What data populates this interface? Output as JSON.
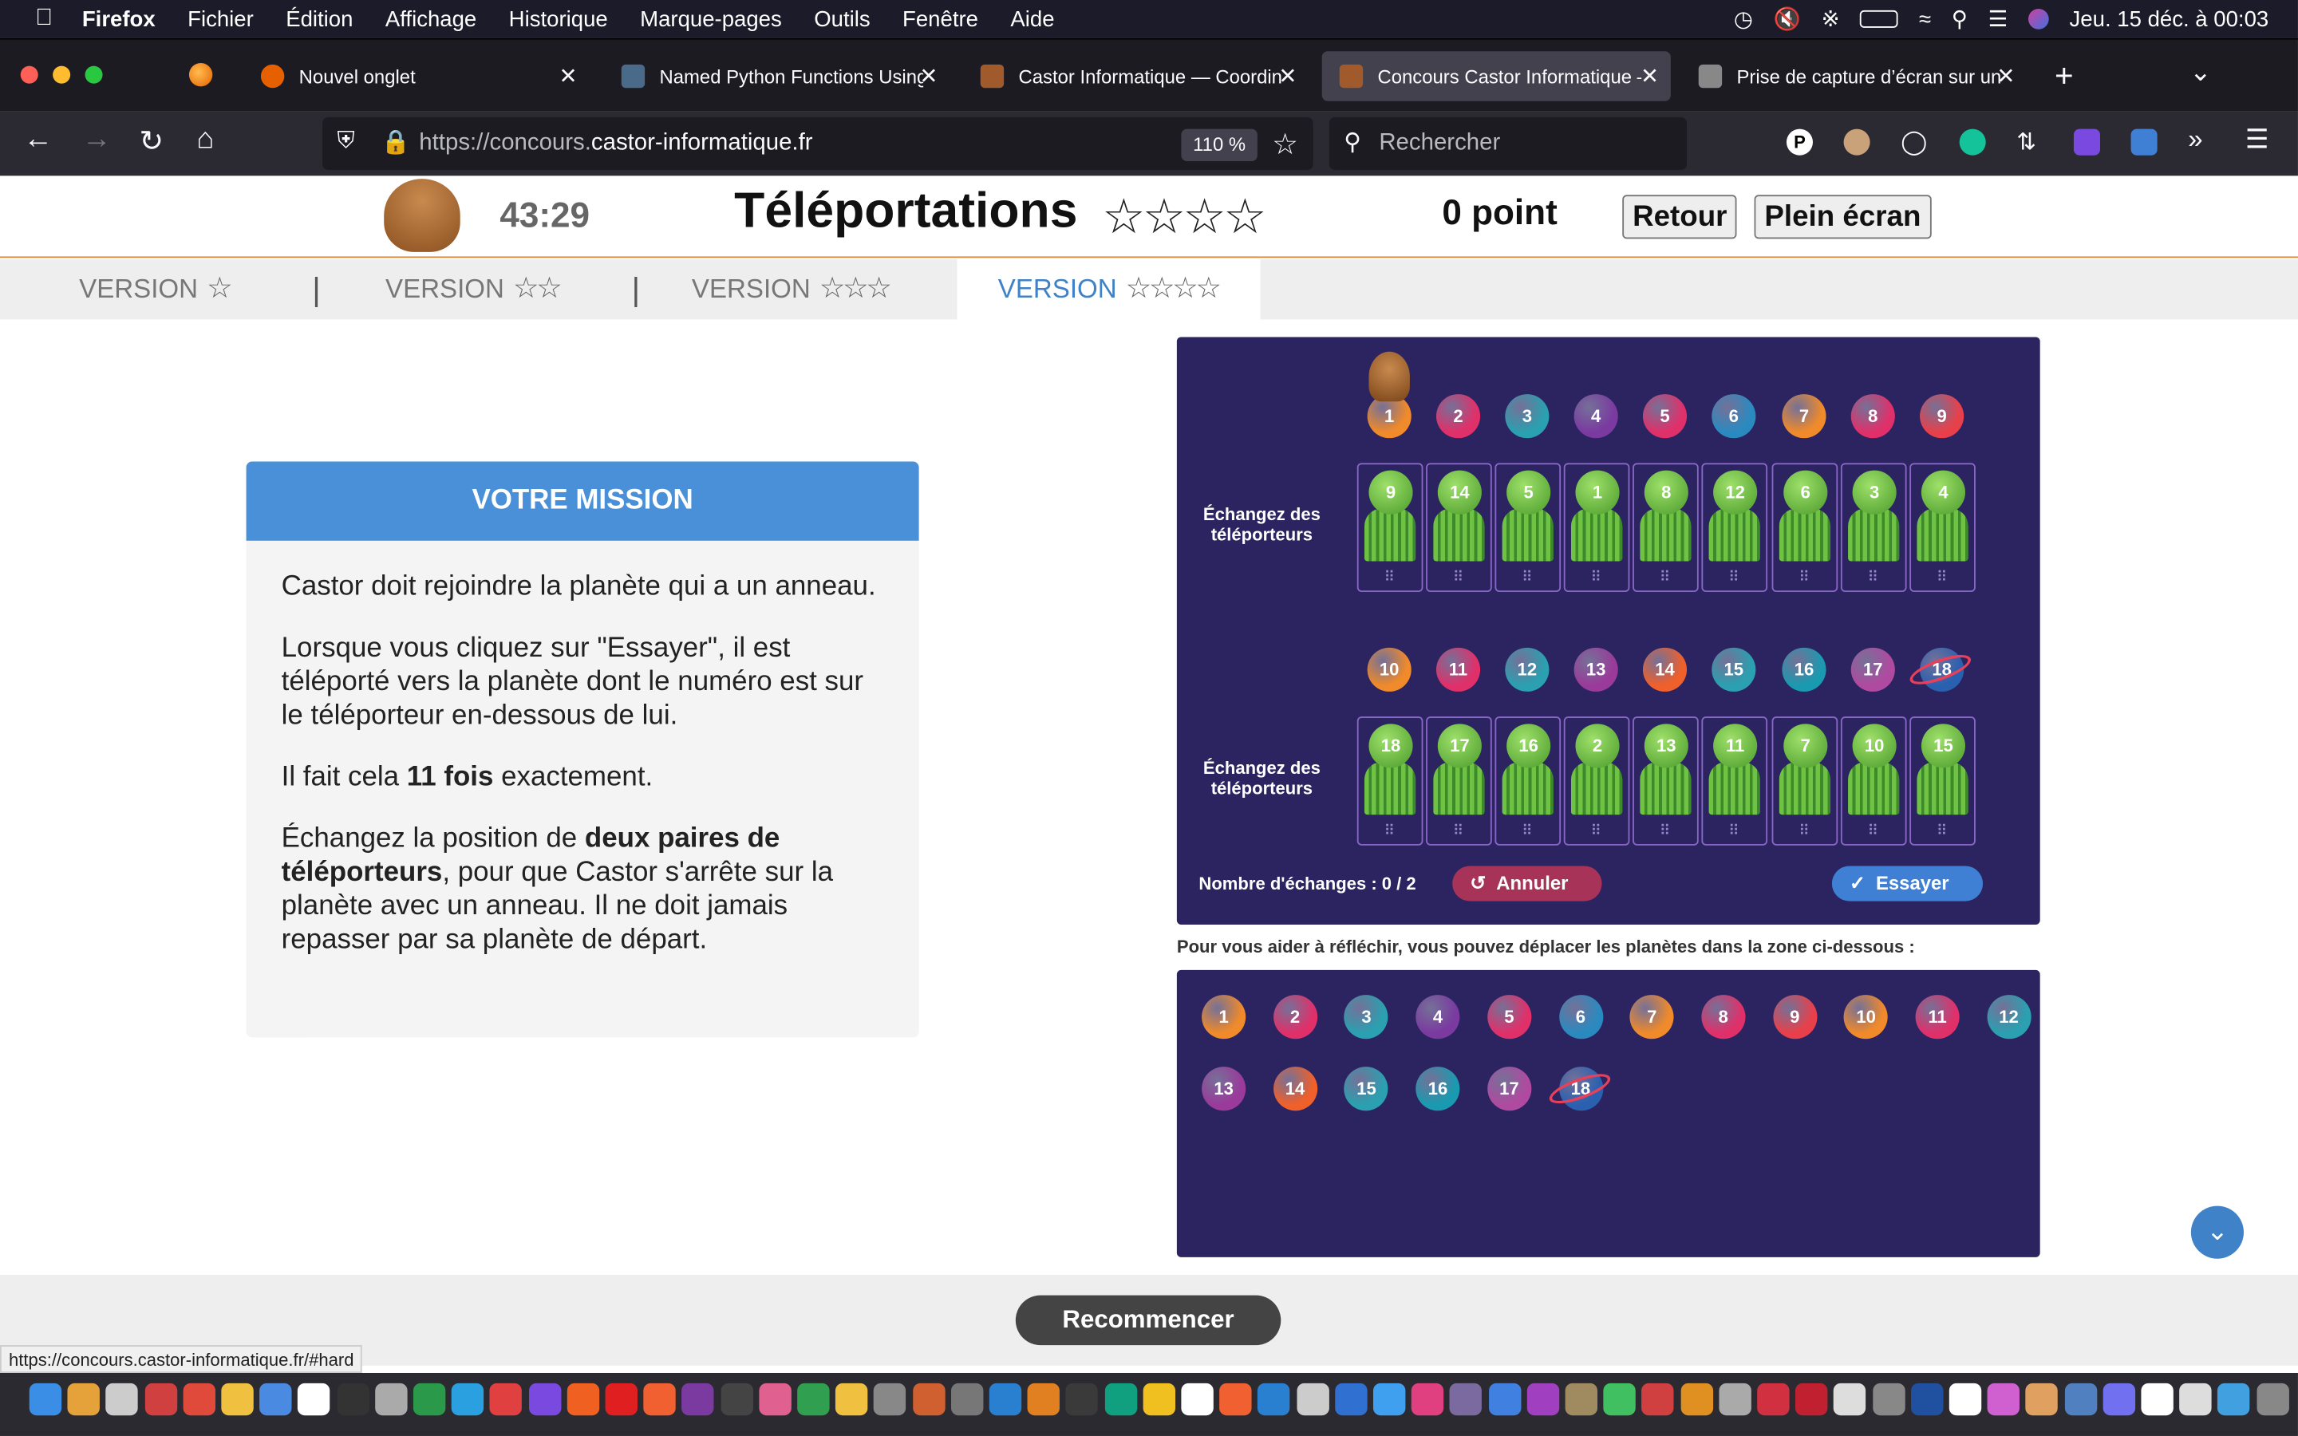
{
  "menubar": {
    "app": "Firefox",
    "items": [
      "Fichier",
      "Édition",
      "Affichage",
      "Historique",
      "Marque-pages",
      "Outils",
      "Fenêtre",
      "Aide"
    ],
    "clock": "Jeu. 15 déc. à  00:03"
  },
  "tabs": [
    {
      "title": "Nouvel onglet",
      "favicon_color": "#e66000"
    },
    {
      "title": "Named Python Functions Using",
      "favicon_color": "#4a6a8a"
    },
    {
      "title": "Castor Informatique — Coordina",
      "favicon_color": "#a05a2c"
    },
    {
      "title": "Concours Castor Informatique –",
      "favicon_color": "#a05a2c"
    },
    {
      "title": "Prise de capture d’écran sur un",
      "favicon_color": "#888888"
    }
  ],
  "url": {
    "prefix": "https://concours.",
    "domain": "castor-informatique.fr",
    "zoom": "110 %"
  },
  "search": {
    "placeholder": "Rechercher"
  },
  "header": {
    "timer": "43:29",
    "title": "Téléportations",
    "stars": "☆☆☆☆",
    "score": "0 point",
    "back": "Retour",
    "fullscreen": "Plein écran"
  },
  "versions": [
    {
      "label": "VERSION",
      "stars": "☆"
    },
    {
      "label": "VERSION",
      "stars": "☆☆"
    },
    {
      "label": "VERSION",
      "stars": "☆☆☆"
    },
    {
      "label": "VERSION",
      "stars": "☆☆☆☆"
    }
  ],
  "mission": {
    "heading": "VOTRE MISSION",
    "p1": "Castor doit rejoindre la planète qui a un anneau.",
    "p2": "Lorsque vous cliquez sur \"Essayer\", il est téléporté vers la planète dont le numéro est sur le téléporteur en-dessous de lui.",
    "p3_a": "Il fait cela ",
    "p3_b": "11 fois",
    "p3_c": " exactement.",
    "p4_a": "Échangez la position de ",
    "p4_b": "deux paires de téléporteurs",
    "p4_c": ", pour que Castor s'arrête sur la planète avec un anneau. Il ne doit jamais repasser par sa planète de départ."
  },
  "game": {
    "row_label_1": "Échangez des",
    "row_label_2": "téléporteurs",
    "planets_row1": [
      {
        "n": "1",
        "color": "#f08a2a"
      },
      {
        "n": "2",
        "color": "#e0306a"
      },
      {
        "n": "3",
        "color": "#2aa0b0"
      },
      {
        "n": "4",
        "color": "#7a3aa0"
      },
      {
        "n": "5",
        "color": "#e0306a"
      },
      {
        "n": "6",
        "color": "#2a8ac0"
      },
      {
        "n": "7",
        "color": "#f08a2a"
      },
      {
        "n": "8",
        "color": "#e0306a"
      },
      {
        "n": "9",
        "color": "#e8404a"
      }
    ],
    "teleporters_row1": [
      "9",
      "14",
      "5",
      "1",
      "8",
      "12",
      "6",
      "3",
      "4"
    ],
    "planets_row2": [
      {
        "n": "10",
        "color": "#f08a2a"
      },
      {
        "n": "11",
        "color": "#e0306a"
      },
      {
        "n": "12",
        "color": "#2aa0b0"
      },
      {
        "n": "13",
        "color": "#9a3a9a"
      },
      {
        "n": "14",
        "color": "#f0602a"
      },
      {
        "n": "15",
        "color": "#2aa0b0"
      },
      {
        "n": "16",
        "color": "#1a9ab0"
      },
      {
        "n": "17",
        "color": "#b04aa0"
      },
      {
        "n": "18",
        "color": "#2a60b0"
      }
    ],
    "teleporters_row2": [
      "18",
      "17",
      "16",
      "2",
      "13",
      "11",
      "7",
      "10",
      "15"
    ],
    "ringed_planet": "18",
    "castor_on": "1",
    "swap_count": "Nombre d'échanges : 0 / 2",
    "undo": "Annuler",
    "try": "Essayer"
  },
  "help_text": "Pour vous aider à réfléchir, vous pouvez déplacer les planètes dans la zone ci-dessous :",
  "restart": "Recommencer",
  "status_url": "https://concours.castor-informatique.fr/#hard"
}
